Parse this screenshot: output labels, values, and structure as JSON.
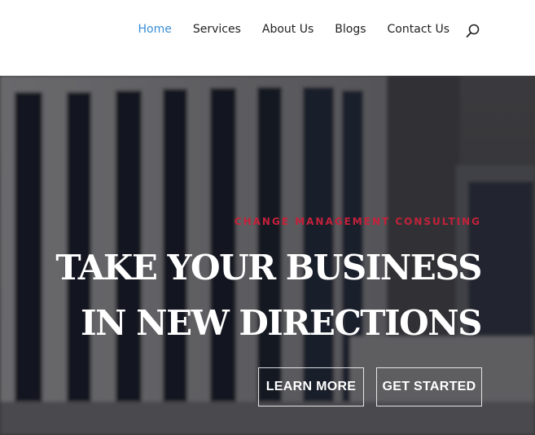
{
  "nav": {
    "items": [
      {
        "label": "Home",
        "active": true
      },
      {
        "label": "Services",
        "active": false
      },
      {
        "label": "About Us",
        "active": false
      },
      {
        "label": "Blogs",
        "active": false
      },
      {
        "label": "Contact Us",
        "active": false
      }
    ],
    "search_icon": "search-icon"
  },
  "hero": {
    "eyebrow": "CHANGE MANAGEMENT CONSULTING",
    "headline_line1": "TAKE YOUR BUSINESS",
    "headline_line2": "IN NEW DIRECTIONS",
    "buttons": {
      "learn_more": "LEARN MORE",
      "get_started": "GET STARTED"
    }
  },
  "colors": {
    "nav_active": "#3a8fd6",
    "nav_text": "#222222",
    "eyebrow": "#c4213a",
    "headline": "#ffffff"
  }
}
